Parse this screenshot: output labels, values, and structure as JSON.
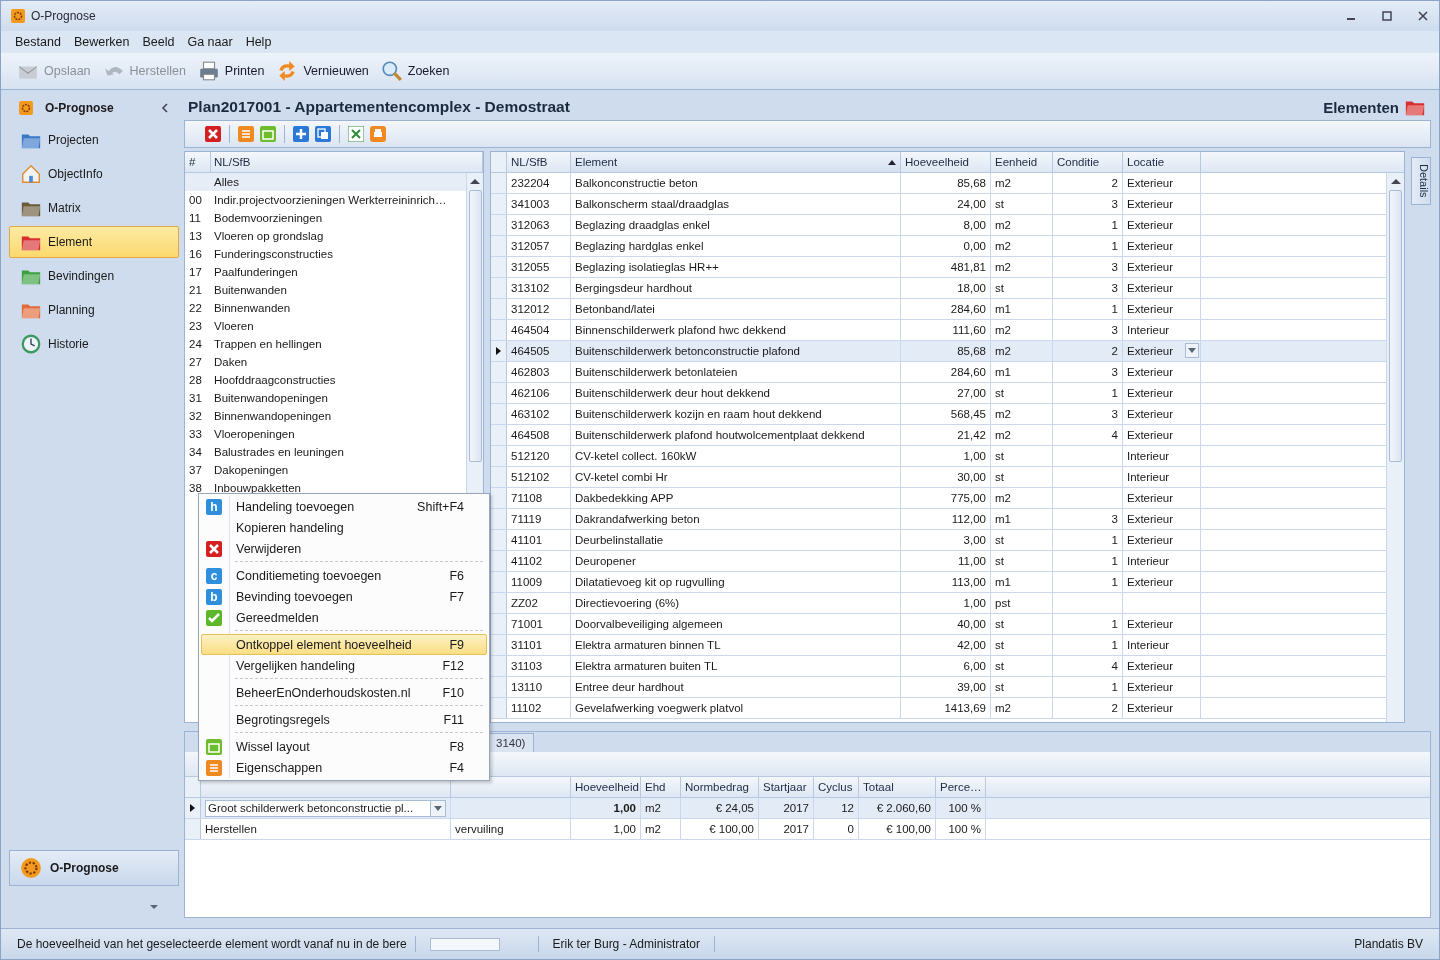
{
  "window": {
    "title": "O-Prognose"
  },
  "menu_bar": [
    "Bestand",
    "Bewerken",
    "Beeld",
    "Ga naar",
    "Help"
  ],
  "toolbar": [
    {
      "label": "Opslaan",
      "disabled": true
    },
    {
      "label": "Herstellen",
      "disabled": true
    },
    {
      "label": "Printen",
      "disabled": false
    },
    {
      "label": "Vernieuwen",
      "disabled": false
    },
    {
      "label": "Zoeken",
      "disabled": false
    }
  ],
  "sidebar": {
    "title": "O-Prognose",
    "items": [
      {
        "label": "Projecten",
        "selected": false
      },
      {
        "label": "ObjectInfo",
        "selected": false
      },
      {
        "label": "Matrix",
        "selected": false
      },
      {
        "label": "Element",
        "selected": true
      },
      {
        "label": "Bevindingen",
        "selected": false
      },
      {
        "label": "Planning",
        "selected": false
      },
      {
        "label": "Historie",
        "selected": false
      }
    ],
    "footer": "O-Prognose"
  },
  "header": {
    "title": "Plan2017001 - Appartementencomplex - Demostraat",
    "section": "Elementen"
  },
  "nlsfb_list": {
    "columns": [
      "#",
      "NL/SfB"
    ],
    "rows": [
      {
        "label": "Alles",
        "selected": true
      },
      {
        "code": "00",
        "label": "Indir.projectvoorzieningen Werkterreininrich…",
        "selected": false
      },
      {
        "code": "11",
        "label": "Bodemvoorzieningen",
        "selected": false
      },
      {
        "code": "13",
        "label": "Vloeren op grondslag",
        "selected": false
      },
      {
        "code": "16",
        "label": "Funderingsconstructies",
        "selected": false
      },
      {
        "code": "17",
        "label": "Paalfunderingen",
        "selected": false
      },
      {
        "code": "21",
        "label": "Buitenwanden",
        "selected": false
      },
      {
        "code": "22",
        "label": "Binnenwanden",
        "selected": false
      },
      {
        "code": "23",
        "label": "Vloeren",
        "selected": false
      },
      {
        "code": "24",
        "label": "Trappen en hellingen",
        "selected": false
      },
      {
        "code": "27",
        "label": "Daken",
        "selected": false
      },
      {
        "code": "28",
        "label": "Hoofddraagconstructies",
        "selected": false
      },
      {
        "code": "31",
        "label": "Buitenwandopeningen",
        "selected": false
      },
      {
        "code": "32",
        "label": "Binnenwandopeningen",
        "selected": false
      },
      {
        "code": "33",
        "label": "Vloeropeningen",
        "selected": false
      },
      {
        "code": "34",
        "label": "Balustrades en leuningen",
        "selected": false
      },
      {
        "code": "37",
        "label": "Dakopeningen",
        "selected": false
      },
      {
        "code": "38",
        "label": "Inbouwpakketten",
        "selected": false
      }
    ]
  },
  "elements_table": {
    "columns": [
      {
        "label": "NL/SfB",
        "sorted": false
      },
      {
        "label": "Element",
        "sorted": true
      },
      {
        "label": "Hoeveelheid",
        "sorted": false
      },
      {
        "label": "Eenheid",
        "sorted": false
      },
      {
        "label": "Conditie",
        "sorted": false
      },
      {
        "label": "Locatie",
        "sorted": false
      }
    ],
    "rows": [
      {
        "cells": [
          "232204",
          "Balkonconstructie beton",
          "85,68",
          "m2",
          "2",
          "Exterieur"
        ],
        "selected": false
      },
      {
        "cells": [
          "341003",
          "Balkonscherm staal/draadglas",
          "24,00",
          "st",
          "3",
          "Exterieur"
        ],
        "selected": false
      },
      {
        "cells": [
          "312063",
          "Beglazing draadglas enkel",
          "8,00",
          "m2",
          "1",
          "Exterieur"
        ],
        "selected": false
      },
      {
        "cells": [
          "312057",
          "Beglazing hardglas enkel",
          "0,00",
          "m2",
          "1",
          "Exterieur"
        ],
        "selected": false
      },
      {
        "cells": [
          "312055",
          "Beglazing isolatieglas HR++",
          "481,81",
          "m2",
          "3",
          "Exterieur"
        ],
        "selected": false
      },
      {
        "cells": [
          "313102",
          "Bergingsdeur hardhout",
          "18,00",
          "st",
          "3",
          "Exterieur"
        ],
        "selected": false
      },
      {
        "cells": [
          "312012",
          "Betonband/latei",
          "284,60",
          "m1",
          "1",
          "Exterieur"
        ],
        "selected": false
      },
      {
        "cells": [
          "464504",
          "Binnenschilderwerk plafond hwc dekkend",
          "111,60",
          "m2",
          "3",
          "Interieur"
        ],
        "selected": false
      },
      {
        "cells": [
          "464505",
          "Buitenschilderwerk betonconstructie plafond",
          "85,68",
          "m2",
          "2",
          "Exterieur"
        ],
        "selected": true
      },
      {
        "cells": [
          "462803",
          "Buitenschilderwerk betonlateien",
          "284,60",
          "m1",
          "3",
          "Exterieur"
        ],
        "selected": false
      },
      {
        "cells": [
          "462106",
          "Buitenschilderwerk deur hout dekkend",
          "27,00",
          "st",
          "1",
          "Exterieur"
        ],
        "selected": false
      },
      {
        "cells": [
          "463102",
          "Buitenschilderwerk kozijn en raam hout dekkend",
          "568,45",
          "m2",
          "3",
          "Exterieur"
        ],
        "selected": false
      },
      {
        "cells": [
          "464508",
          "Buitenschilderwerk plafond houtwolcementplaat dekkend",
          "21,42",
          "m2",
          "4",
          "Exterieur"
        ],
        "selected": false
      },
      {
        "cells": [
          "512120",
          "CV-ketel collect. 160kW",
          "1,00",
          "st",
          null,
          "Interieur"
        ],
        "selected": false
      },
      {
        "cells": [
          "512102",
          "CV-ketel combi Hr",
          "30,00",
          "st",
          null,
          "Interieur"
        ],
        "selected": false
      },
      {
        "cells": [
          "71108",
          "Dakbedekking APP",
          "775,00",
          "m2",
          null,
          "Exterieur"
        ],
        "selected": false
      },
      {
        "cells": [
          "71119",
          "Dakrandafwerking beton",
          "112,00",
          "m1",
          "3",
          "Exterieur"
        ],
        "selected": false
      },
      {
        "cells": [
          "41101",
          "Deurbelinstallatie",
          "3,00",
          "st",
          "1",
          "Exterieur"
        ],
        "selected": false
      },
      {
        "cells": [
          "41102",
          "Deuropener",
          "11,00",
          "st",
          "1",
          "Interieur"
        ],
        "selected": false
      },
      {
        "cells": [
          "11009",
          "Dilatatievoeg kit op rugvulling",
          "113,00",
          "m1",
          "1",
          "Exterieur"
        ],
        "selected": false
      },
      {
        "cells": [
          "ZZ02",
          "Directievoering (6%)",
          "1,00",
          "pst",
          null,
          null
        ],
        "selected": false
      },
      {
        "cells": [
          "71001",
          "Doorvalbeveiliging algemeen",
          "40,00",
          "st",
          "1",
          "Exterieur"
        ],
        "selected": false
      },
      {
        "cells": [
          "31101",
          "Elektra armaturen binnen TL",
          "42,00",
          "st",
          "1",
          "Interieur"
        ],
        "selected": false
      },
      {
        "cells": [
          "31103",
          "Elektra armaturen buiten TL",
          "6,00",
          "st",
          "4",
          "Exterieur"
        ],
        "selected": false
      },
      {
        "cells": [
          "13110",
          "Entree deur hardhout",
          "39,00",
          "st",
          "1",
          "Exterieur"
        ],
        "selected": false
      },
      {
        "cells": [
          "11102",
          "Gevelafwerking voegwerk platvol",
          "1413,69",
          "m2",
          "2",
          "Exterieur"
        ],
        "selected": false
      }
    ]
  },
  "details_tab": "Details",
  "context_menu": {
    "items": [
      {
        "kind": "letter",
        "label": "Handeling toevoegen",
        "shortcut": "Shift+F4",
        "icon_text": "h",
        "selected": false,
        "separator_after": false
      },
      {
        "kind": "plain",
        "label": "Kopieren handeling",
        "selected": false,
        "separator_after": false
      },
      {
        "kind": "delete",
        "label": "Verwijderen",
        "selected": false,
        "separator_after": true
      },
      {
        "kind": "letter",
        "label": "Conditiemeting toevoegen",
        "shortcut": "F6",
        "icon_text": "c",
        "selected": false,
        "separator_after": false
      },
      {
        "kind": "letter",
        "label": "Bevinding toevoegen",
        "shortcut": "F7",
        "icon_text": "b",
        "selected": false,
        "separator_after": false
      },
      {
        "kind": "check",
        "label": "Gereedmelden",
        "selected": false,
        "separator_after": true
      },
      {
        "kind": "plain",
        "label": "Ontkoppel element hoeveelheid",
        "shortcut": "F9",
        "selected": true,
        "separator_after": false
      },
      {
        "kind": "plain",
        "label": "Vergelijken handeling",
        "shortcut": "F12",
        "selected": false,
        "separator_after": true
      },
      {
        "kind": "plain",
        "label": "BeheerEnOnderhoudskosten.nl",
        "shortcut": "F10",
        "selected": false,
        "separator_after": true
      },
      {
        "kind": "plain",
        "label": "Begrotingsregels",
        "shortcut": "F11",
        "selected": false,
        "separator_after": true
      },
      {
        "kind": "layout",
        "label": "Wissel layout",
        "shortcut": "F8",
        "selected": false,
        "separator_after": false
      },
      {
        "kind": "properties",
        "label": "Eigenschappen",
        "shortcut": "F4",
        "selected": false,
        "separator_after": false
      }
    ]
  },
  "lower_tabs": [
    {
      "label": "3140)",
      "selected": false
    }
  ],
  "actions_table": {
    "columns": [
      null,
      null,
      "Hoeveelheid",
      "Ehd",
      "Normbedrag",
      "Startjaar",
      "Cyclus",
      "Totaal",
      "Perce…"
    ],
    "rows": [
      {
        "cells": [
          "Groot schilderwerk betonconstructie pl...",
          null,
          "1,00",
          "m2",
          "€ 24,05",
          "2017",
          "12",
          "€ 2.060,60",
          "100 %"
        ],
        "selected": true
      },
      {
        "cells": [
          "Herstellen",
          "vervuiling",
          "1,00",
          "m2",
          "€ 100,00",
          "2017",
          "0",
          "€ 100,00",
          "100 %"
        ],
        "selected": false
      }
    ]
  },
  "status_bar": {
    "message": "De hoeveelheid van het geselecteerde element wordt vanaf nu in de bere",
    "progress": {
      "level": 0
    },
    "user": "Erik ter Burg - Administrator",
    "company": "Plandatis BV"
  }
}
